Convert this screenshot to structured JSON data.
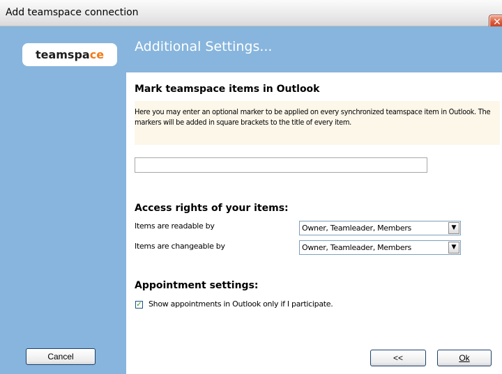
{
  "window": {
    "title": "Add teamspace connection",
    "close_glyph": "✕"
  },
  "sidebar": {
    "logo_text": "teamspa",
    "logo_mark": "ce",
    "cancel_label": "Cancel"
  },
  "header": {
    "title": "Additional Settings..."
  },
  "marker_section": {
    "heading": "Mark teamspace items in Outlook",
    "description": "Here you may enter an optional marker to be applied on every synchronized teamspace item in Outlook. The markers will be added in square brackets to the title of every item.",
    "marker_value": ""
  },
  "access_section": {
    "heading": "Access rights of your items:",
    "readable_label": "Items are readable by",
    "readable_value": "Owner, Teamleader, Members",
    "changeable_label": "Items are changeable by",
    "changeable_value": "Owner, Teamleader, Members"
  },
  "appointment_section": {
    "heading": "Appointment settings:",
    "checkbox_label": "Show appointments in Outlook only if I participate.",
    "checkbox_checked": true
  },
  "footer": {
    "back_label": "<<",
    "ok_label": "Ok"
  },
  "colors": {
    "panel_blue": "#87b5dd",
    "info_background": "#fdf7ea",
    "close_red": "#d95a3b",
    "logo_accent": "#f07a1a"
  }
}
